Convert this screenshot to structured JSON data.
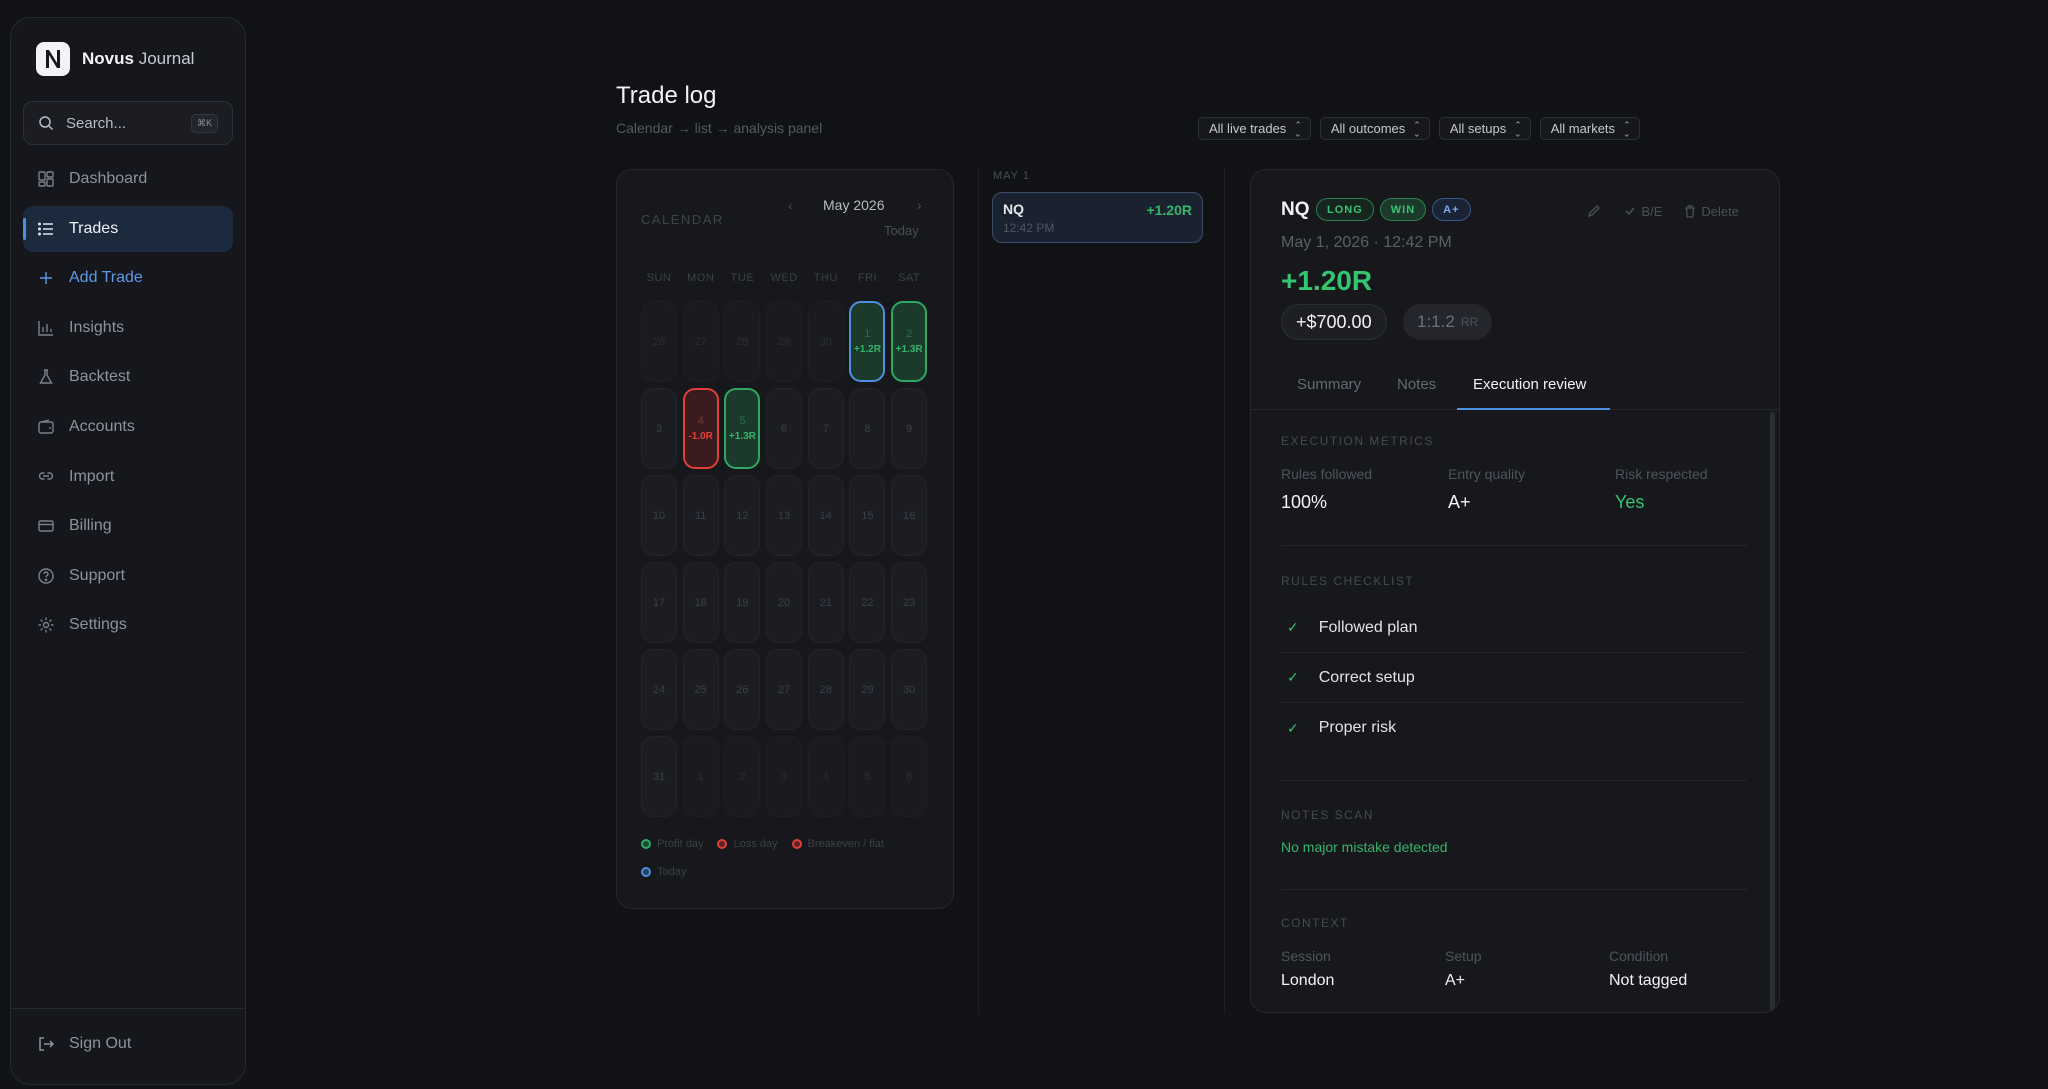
{
  "app": {
    "brand_bold": "Novus",
    "brand_light": "Journal",
    "logo_letter": "N"
  },
  "search": {
    "placeholder": "Search...",
    "shortcut": "⌘K"
  },
  "nav": [
    {
      "label": "Dashboard",
      "icon": "dashboard-icon"
    },
    {
      "label": "Trades",
      "icon": "list-icon",
      "active": true
    },
    {
      "label": "Add Trade",
      "icon": "plus-icon",
      "accent": true
    },
    {
      "label": "Insights",
      "icon": "bar-chart-icon"
    },
    {
      "label": "Backtest",
      "icon": "flask-icon"
    },
    {
      "label": "Accounts",
      "icon": "wallet-icon"
    },
    {
      "label": "Import",
      "icon": "link-icon"
    },
    {
      "label": "Billing",
      "icon": "card-icon"
    },
    {
      "label": "Support",
      "icon": "help-icon"
    },
    {
      "label": "Settings",
      "icon": "gear-icon"
    }
  ],
  "signout": "Sign Out",
  "header": {
    "title": "Trade log",
    "subtitle": "Calendar → list → analysis panel"
  },
  "filters": [
    "All live trades",
    "All outcomes",
    "All setups",
    "All markets"
  ],
  "calendar": {
    "label": "CALENDAR",
    "month": "May 2026",
    "prev": "‹",
    "next": "›",
    "today_btn": "Today",
    "weekdays": [
      "SUN",
      "MON",
      "TUE",
      "WED",
      "THU",
      "FRI",
      "SAT"
    ],
    "days": [
      {
        "d": "26",
        "s": "muted"
      },
      {
        "d": "27",
        "s": "muted"
      },
      {
        "d": "28",
        "s": "muted"
      },
      {
        "d": "29",
        "s": "muted"
      },
      {
        "d": "30",
        "s": "muted"
      },
      {
        "d": "1",
        "s": "today",
        "r": "+1.2R"
      },
      {
        "d": "2",
        "s": "profit",
        "r": "+1.3R"
      },
      {
        "d": "3"
      },
      {
        "d": "4",
        "s": "loss",
        "r": "-1.0R"
      },
      {
        "d": "5",
        "s": "profit",
        "r": "+1.3R"
      },
      {
        "d": "6"
      },
      {
        "d": "7"
      },
      {
        "d": "8"
      },
      {
        "d": "9"
      },
      {
        "d": "10"
      },
      {
        "d": "11"
      },
      {
        "d": "12"
      },
      {
        "d": "13"
      },
      {
        "d": "14"
      },
      {
        "d": "15"
      },
      {
        "d": "16"
      },
      {
        "d": "17"
      },
      {
        "d": "18"
      },
      {
        "d": "19"
      },
      {
        "d": "20"
      },
      {
        "d": "21"
      },
      {
        "d": "22"
      },
      {
        "d": "23"
      },
      {
        "d": "24"
      },
      {
        "d": "25"
      },
      {
        "d": "26"
      },
      {
        "d": "27"
      },
      {
        "d": "28"
      },
      {
        "d": "29"
      },
      {
        "d": "30"
      },
      {
        "d": "31"
      },
      {
        "d": "1",
        "s": "muted"
      },
      {
        "d": "2",
        "s": "muted"
      },
      {
        "d": "3",
        "s": "muted"
      },
      {
        "d": "4",
        "s": "muted"
      },
      {
        "d": "5",
        "s": "muted"
      },
      {
        "d": "6",
        "s": "muted"
      }
    ],
    "legend": [
      {
        "label": "Profit day",
        "color": "#2fa863"
      },
      {
        "label": "Loss day",
        "color": "#e0403a"
      },
      {
        "label": "Breakeven / flat",
        "color": "#e0403a"
      },
      {
        "label": "Today",
        "color": "#4d8fe0"
      }
    ]
  },
  "list": {
    "date": "MAY 1",
    "trades": [
      {
        "symbol": "NQ",
        "r": "+1.20R",
        "time": "12:42 PM"
      }
    ]
  },
  "detail": {
    "symbol": "NQ",
    "badges": [
      "LONG",
      "WIN",
      "A+"
    ],
    "actions": {
      "be": "B/E",
      "delete": "Delete"
    },
    "datetime": "May 1, 2026 · 12:42 PM",
    "r": "+1.20R",
    "amount": "+$700.00",
    "rr": "1:1.2",
    "rr_unit": "RR",
    "tabs": [
      "Summary",
      "Notes",
      "Execution review"
    ],
    "active_tab": 2,
    "execution": {
      "title": "EXECUTION METRICS",
      "metrics": [
        {
          "label": "Rules followed",
          "value": "100%"
        },
        {
          "label": "Entry quality",
          "value": "A+"
        },
        {
          "label": "Risk respected",
          "value": "Yes"
        }
      ]
    },
    "checklist": {
      "title": "RULES CHECKLIST",
      "items": [
        "Followed plan",
        "Correct setup",
        "Proper risk"
      ],
      "mark": "✓"
    },
    "notes_scan": {
      "title": "NOTES SCAN",
      "text": "No major mistake detected"
    },
    "context": {
      "title": "CONTEXT",
      "items": [
        {
          "label": "Session",
          "value": "London"
        },
        {
          "label": "Setup",
          "value": "A+"
        },
        {
          "label": "Condition",
          "value": "Not tagged"
        }
      ]
    }
  },
  "colors": {
    "accent": "#4d8fe0",
    "profit": "#35c46f",
    "loss": "#e0403a",
    "bg": "#111215"
  }
}
